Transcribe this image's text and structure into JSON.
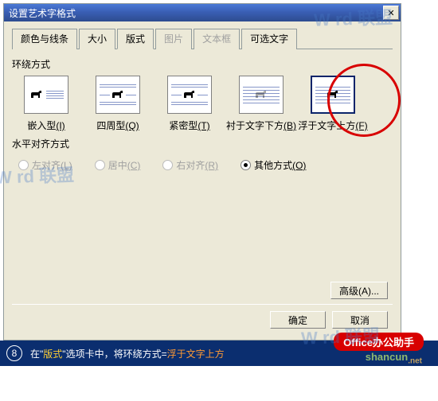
{
  "dialog": {
    "title": "设置艺术字格式",
    "tabs": {
      "colors": "颜色与线条",
      "size": "大小",
      "layout": "版式",
      "picture": "图片",
      "textbox": "文本框",
      "alttext": "可选文字"
    },
    "wrap": {
      "group_label": "环绕方式",
      "options": {
        "inline": {
          "label": "嵌入型",
          "key": "(I)"
        },
        "square": {
          "label": "四周型",
          "key": "(Q)"
        },
        "tight": {
          "label": "紧密型",
          "key": "(T)"
        },
        "behind": {
          "label": "衬于文字下方",
          "key": "(B)"
        },
        "front": {
          "label": "浮于文字上方",
          "key": "(F)"
        }
      }
    },
    "align": {
      "group_label": "水平对齐方式",
      "left": {
        "label": "左对齐",
        "key": "(L)"
      },
      "center": {
        "label": "居中",
        "key": "(C)"
      },
      "right": {
        "label": "右对齐",
        "key": "(R)"
      },
      "other": {
        "label": "其他方式",
        "key": "(O)"
      }
    },
    "buttons": {
      "advanced": "高级(A)...",
      "ok": "确定",
      "cancel": "取消"
    }
  },
  "footer": {
    "step": "8",
    "t1": "在",
    "q1": "\"",
    "tab": "版式",
    "q2": "\"",
    "t2": "选项卡中，将环绕方式=",
    "val": "浮于文字上方",
    "pill": "Office办公助手"
  },
  "watermark": {
    "brand": "W  rd 联盟",
    "site": "shancun",
    "tld": ".net"
  }
}
